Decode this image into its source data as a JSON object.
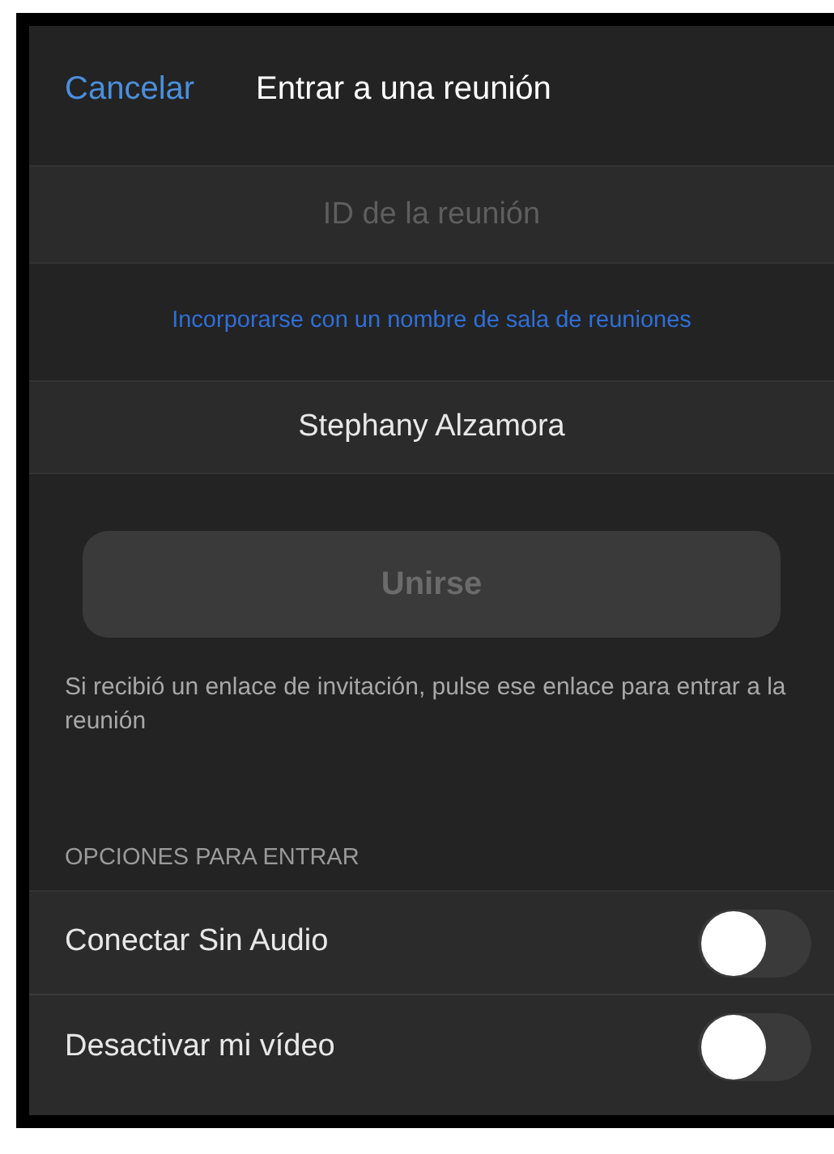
{
  "header": {
    "cancel": "Cancelar",
    "title": "Entrar a una reunión"
  },
  "meeting_id": {
    "placeholder": "ID de la reunión"
  },
  "room_link": "Incorporarse con un nombre de sala de reuniones",
  "name_field": {
    "value": "Stephany Alzamora"
  },
  "join_button": {
    "label": "Unirse",
    "disabled": true
  },
  "help_text": "Si recibió un enlace de invitación, pulse ese enlace para entrar a la reunión",
  "options_heading": "OPCIONES PARA ENTRAR",
  "options": [
    {
      "label": "Conectar Sin Audio",
      "on": false
    },
    {
      "label": "Desactivar mi vídeo",
      "on": false
    }
  ]
}
